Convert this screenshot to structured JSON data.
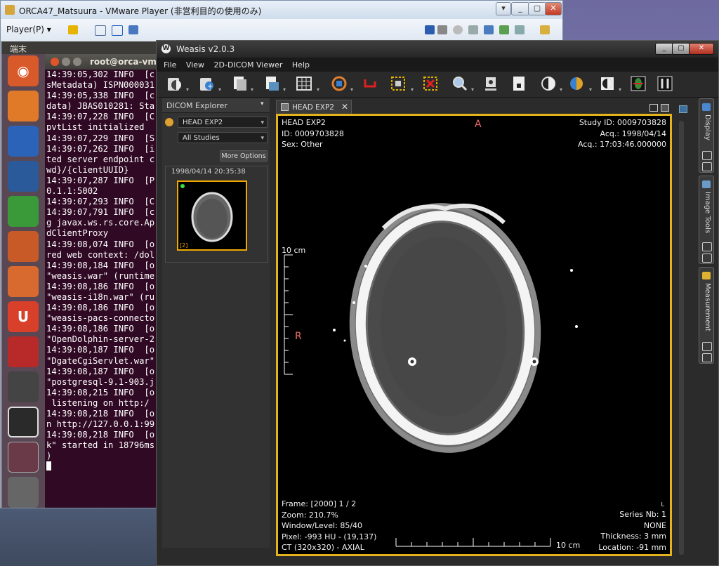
{
  "vmware": {
    "title": "ORCA47_Matsuura - VMware Player (非営利目的の使用のみ)",
    "player_menu": "Player(P) ▾",
    "controls": [
      "▾",
      "_",
      "▢",
      "✕"
    ]
  },
  "ubuntu": {
    "panel_title": "端末",
    "terminal_title": "root@orca-vm: /",
    "terminal_lines": [
      "14:39:05,302 INFO  [c",
      "sMetadata) ISPN000031",
      "14:39:05,338 INFO  [c",
      "data) JBAS010281: Sta",
      "14:39:07,228 INFO  [C",
      "pvtList initialized",
      "14:39:07,229 INFO  [S",
      "14:39:07,262 INFO  [i",
      "ted server endpoint c",
      "wd}/{clientUUID}",
      "14:39:07,287 INFO  [P",
      "0.1.1:5002",
      "14:39:07,293 INFO  [C",
      "14:39:07,791 INFO  [c",
      "g javax.ws.rs.core.Ap",
      "dClientProxy",
      "14:39:08,074 INFO  [o",
      "red web context: /dol",
      "14:39:08,184 INFO  [o",
      "\"weasis.war\" (runtime",
      "14:39:08,186 INFO  [o",
      "\"weasis-i18n.war\" (ru",
      "14:39:08,186 INFO  [o",
      "\"weasis-pacs-connecto",
      "14:39:08,186 INFO  [o",
      "\"OpenDolphin-server-2",
      "14:39:08,187 INFO  [o",
      "\"DgateCgiServlet.war\"",
      "14:39:08,187 INFO  [o",
      "\"postgresql-9.1-903.j",
      "14:39:08,215 INFO  [o",
      " listening on http:/",
      "14:39:08,218 INFO  [o",
      "n http://127.0.0.1:99",
      "14:39:08,218 INFO  [o",
      "k\" started in 18796ms",
      ")"
    ]
  },
  "weasis": {
    "title": "Weasis v2.0.3",
    "menus": [
      "File",
      "View",
      "2D-DICOM Viewer",
      "Help"
    ],
    "window_controls": [
      "_",
      "▢",
      "✕"
    ],
    "explorer": {
      "tab_label": "DICOM Explorer",
      "patient": "HEAD EXP2",
      "studies": "All Studies",
      "more_options": "More Options",
      "study_date": "1998/04/14 20:35:38",
      "thumb_count": "[2]"
    },
    "viewer_tab": "HEAD EXP2",
    "overlay": {
      "top_left": [
        "HEAD EXP2",
        "ID: 0009703828",
        "Sex: Other"
      ],
      "top_right": [
        "Study ID: 0009703828",
        "Acq.: 1998/04/14",
        "Acq.: 17:03:46.000000"
      ],
      "bottom_left": [
        "Frame: [2000] 1 / 2",
        "Zoom: 210.7%",
        "Window/Level: 85/40",
        "Pixel: -993 HU - (19,137)",
        "CT (320x320) - AXIAL"
      ],
      "bottom_right": [
        "Series Nb: 1",
        "NONE",
        "Thickness: 3 mm",
        "Location: -91 mm"
      ],
      "orientation_top": "A",
      "orientation_left": "R",
      "scale_vertical": "10 cm",
      "scale_horizontal": "10 cm",
      "corner_mark": "L"
    },
    "dock": [
      "Display",
      "Image Tools",
      "Measurement"
    ]
  }
}
